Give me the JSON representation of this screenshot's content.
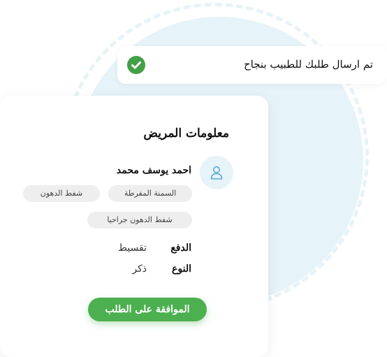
{
  "notification": {
    "message": "تم ارسال طلبك للطبيب بنجاح",
    "icon": "check-circle-icon",
    "icon_color": "#43a047"
  },
  "patient_card": {
    "title": "معلومات المريض",
    "avatar_icon": "user-icon",
    "patient_name": "احمد يوسف محمد",
    "tags": [
      "السمنة المفرطة",
      "شفط الدهون",
      "شفط الدهون جراحيا"
    ],
    "payment_label": "الدفع",
    "payment_value": "تقسيط",
    "gender_label": "النوع",
    "gender_value": "ذكر",
    "approve_button": "الموافقة على الطلب"
  },
  "colors": {
    "accent": "#4caf50",
    "background_circle": "#e6f3f8",
    "avatar_icon": "#5aa9d6"
  }
}
